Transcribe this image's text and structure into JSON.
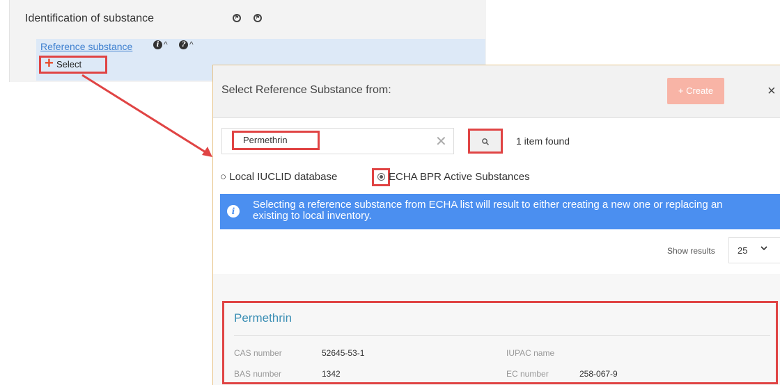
{
  "section": {
    "title": "Identification of substance"
  },
  "reference": {
    "label": "Reference substance",
    "select_label": "Select"
  },
  "dialog": {
    "title": "Select Reference Substance from:",
    "create_label": "+ Create",
    "close_glyph": "×",
    "search": {
      "value": "Permethrin",
      "clear_glyph": "✕",
      "button_glyph": "🔍"
    },
    "found_text": "1 item found",
    "radio_local": "Local IUCLID database",
    "radio_echa": "ECHA BPR Active Substances",
    "info_text": "Selecting a reference substance from ECHA list will result to either creating a new one or replacing an existing to local inventory.",
    "show_results_label": "Show results",
    "show_results_value": "25",
    "result": {
      "name": "Permethrin",
      "cas_label": "CAS number",
      "cas_value": "52645-53-1",
      "iupac_label": "IUPAC name",
      "iupac_value": "",
      "bas_label": "BAS number",
      "bas_value": "1342",
      "ec_label": "EC number",
      "ec_value": "258-067-9"
    }
  },
  "colors": {
    "highlight_red": "#e04444",
    "link_blue": "#3d7fcf",
    "banner_blue": "#4b8ff0",
    "create_button": "#f8b4a6"
  }
}
